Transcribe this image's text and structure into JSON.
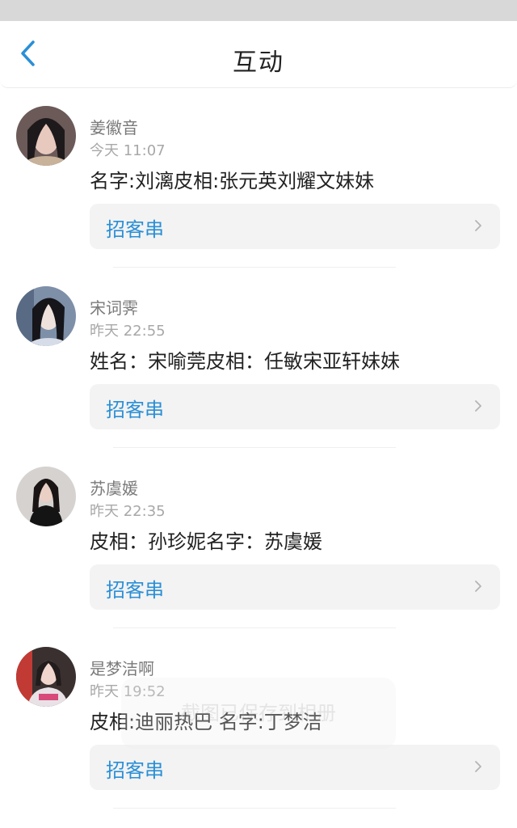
{
  "header": {
    "title": "互动",
    "back_icon": "chevron-left-icon",
    "accent_color": "#2a8fd6"
  },
  "posts": [
    {
      "username": "姜徽音",
      "time": "今天 11:07",
      "content": "名字:刘漓皮相:张元英刘耀文妹妹",
      "card_label": "招客串"
    },
    {
      "username": "宋词霁",
      "time": "昨天 22:55",
      "content": "姓名：宋喻莞皮相：任敏宋亚轩妹妹",
      "card_label": "招客串"
    },
    {
      "username": "苏虞媛",
      "time": "昨天 22:35",
      "content": "皮相：孙珍妮名字：苏虞媛",
      "card_label": "招客串"
    },
    {
      "username": "是梦洁啊",
      "time": "昨天 19:52",
      "content": "皮相:迪丽热巴 名字:丁梦洁",
      "card_label": "招客串"
    }
  ],
  "toast": {
    "text": "截图已保存到相册"
  }
}
